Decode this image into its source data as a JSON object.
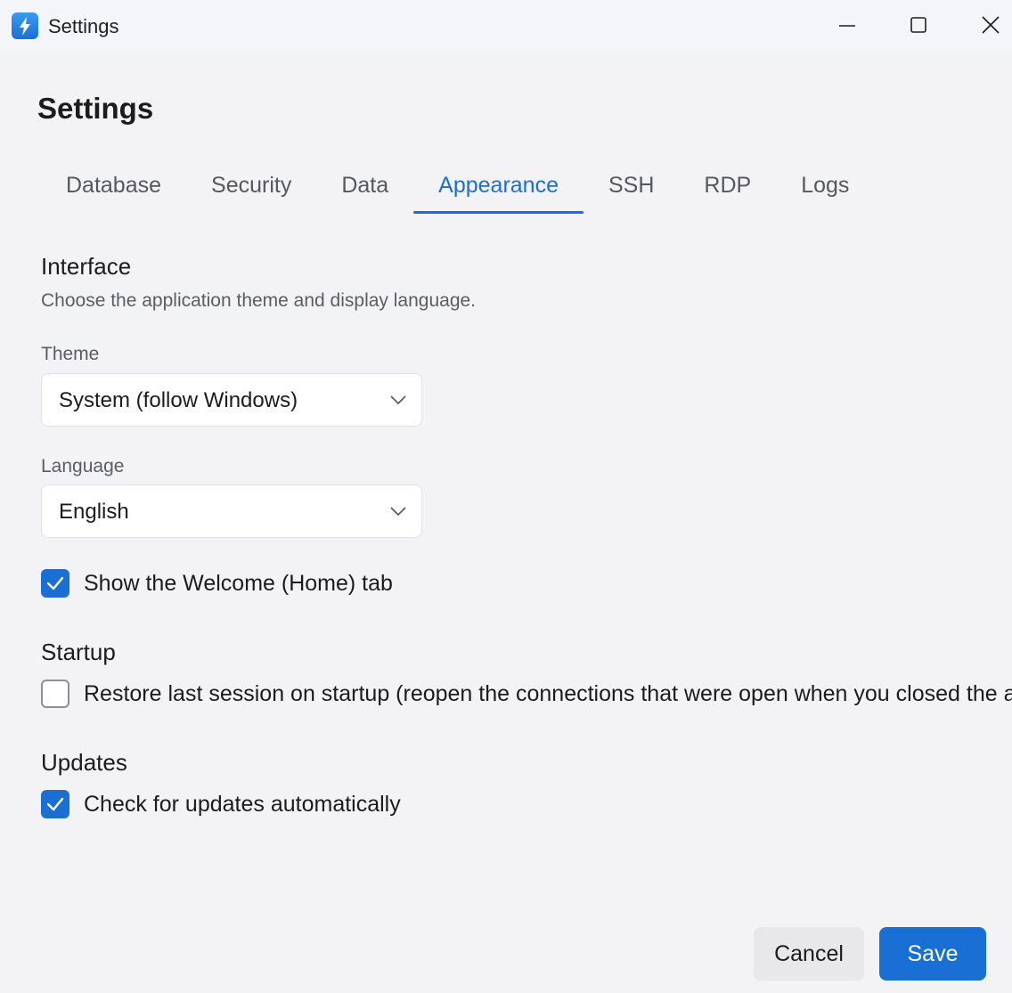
{
  "window": {
    "title": "Settings"
  },
  "page": {
    "title": "Settings"
  },
  "tabs": [
    {
      "label": "Database",
      "active": false
    },
    {
      "label": "Security",
      "active": false
    },
    {
      "label": "Data",
      "active": false
    },
    {
      "label": "Appearance",
      "active": true
    },
    {
      "label": "SSH",
      "active": false
    },
    {
      "label": "RDP",
      "active": false
    },
    {
      "label": "Logs",
      "active": false
    }
  ],
  "interface": {
    "heading": "Interface",
    "description": "Choose the application theme and display language.",
    "theme": {
      "label": "Theme",
      "value": "System (follow Windows)"
    },
    "language": {
      "label": "Language",
      "value": "English"
    },
    "show_welcome": {
      "label": "Show the Welcome (Home) tab",
      "checked": true
    }
  },
  "startup": {
    "heading": "Startup",
    "restore_session": {
      "label": "Restore last session on startup (reopen the connections that were open when you closed the app)",
      "checked": false
    }
  },
  "updates": {
    "heading": "Updates",
    "auto_check": {
      "label": "Check for updates automatically",
      "checked": true
    }
  },
  "footer": {
    "cancel_label": "Cancel",
    "save_label": "Save"
  },
  "icons": {
    "app": "lightning-bolt-icon",
    "minimize": "minimize-icon",
    "maximize": "maximize-icon",
    "close": "close-icon",
    "dropdown": "chevron-down-icon",
    "check": "checkmark-icon"
  },
  "colors": {
    "accent": "#1a6fd4",
    "window_background": "#f3f3f5",
    "text_secondary": "#5a5d63"
  }
}
